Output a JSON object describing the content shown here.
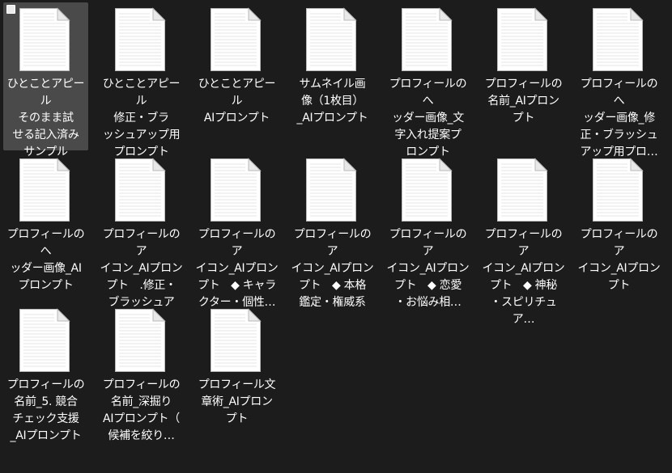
{
  "files": [
    {
      "name": "ひとことアピール\nそのまま試\nせる記入済み\nサンプル",
      "selected": true
    },
    {
      "name": "ひとことアピール\n修正・ブラ\nッシュアップ用\nプロンプト",
      "selected": false
    },
    {
      "name": "ひとことアピール\nAIプロンプト",
      "selected": false
    },
    {
      "name": "サムネイル画\n像（1枚目）\n_AIプロンプト",
      "selected": false
    },
    {
      "name": "プロフィールのへ\nッダー画像_文\n字入れ提案プ\nロンプト",
      "selected": false
    },
    {
      "name": "プロフィールの\n名前_AIプロン\nプト",
      "selected": false
    },
    {
      "name": "プロフィールのへ\nッダー画像_修\n正・ブラッシュ\nアップ用プロ…",
      "selected": false
    },
    {
      "name": "プロフィールのへ\nッダー画像_AI\nプロンプト",
      "selected": false
    },
    {
      "name": "プロフィールのア\nイコン_AIプロン\nプト　.修正・\nブラッシュアッ…",
      "selected": false
    },
    {
      "name": "プロフィールのア\nイコン_AIプロン\nプト　◆ キャラ\nクター・個性…",
      "selected": false
    },
    {
      "name": "プロフィールのア\nイコン_AIプロン\nプト　◆ 本格\n鑑定・権威系",
      "selected": false
    },
    {
      "name": "プロフィールのア\nイコン_AIプロン\nプト　◆ 恋愛\n・お悩み相…",
      "selected": false
    },
    {
      "name": "プロフィールのア\nイコン_AIプロン\nプト　◆ 神秘\n・スピリチュア…",
      "selected": false
    },
    {
      "name": "プロフィールのア\nイコン_AIプロン\nプト",
      "selected": false
    },
    {
      "name": "プロフィールの\n名前_5. 競合\nチェック支援\n_AIプロンプト",
      "selected": false
    },
    {
      "name": "プロフィールの\n名前_深掘り\nAIプロンプト（\n候補を絞り…",
      "selected": false
    },
    {
      "name": "プロフィール文\n章術_AIプロン\nプト",
      "selected": false
    }
  ],
  "icon": "text-document-icon",
  "colors": {
    "background": "#1c1c1c",
    "selection": "#4a4a4a",
    "text": "#ffffff"
  }
}
